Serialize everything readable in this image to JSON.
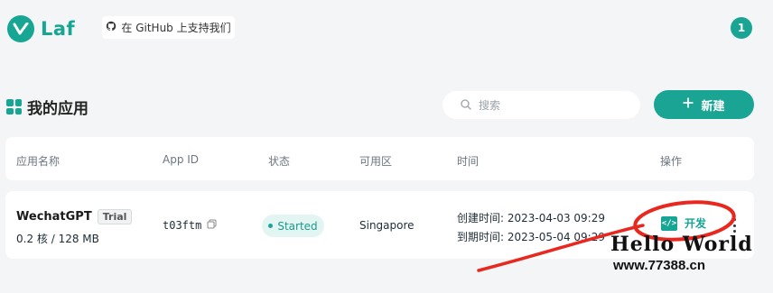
{
  "brand": {
    "name": "Laf"
  },
  "github": {
    "label": "在 GitHub 上支持我们"
  },
  "user": {
    "avatar_text": "1"
  },
  "section": {
    "title": "我的应用"
  },
  "search": {
    "placeholder": "搜索"
  },
  "new_button": {
    "label": "新建"
  },
  "table": {
    "headers": [
      "应用名称",
      "App ID",
      "状态",
      "可用区",
      "时间",
      "操作"
    ],
    "rows": [
      {
        "name": "WechatGPT",
        "plan": "Trial",
        "spec": "0.2 核 / 128 MB",
        "app_id": "t03ftm",
        "status": "Started",
        "region": "Singapore",
        "created": "创建时间: 2023-04-03 09:29",
        "expires": "到期时间: 2023-05-04 09:29",
        "action": "开发"
      }
    ]
  },
  "watermark": {
    "line1": "Hello World",
    "line2": "www.77388.cn"
  },
  "colors": {
    "accent": "#1aa493",
    "annotation": "#e8271e"
  }
}
